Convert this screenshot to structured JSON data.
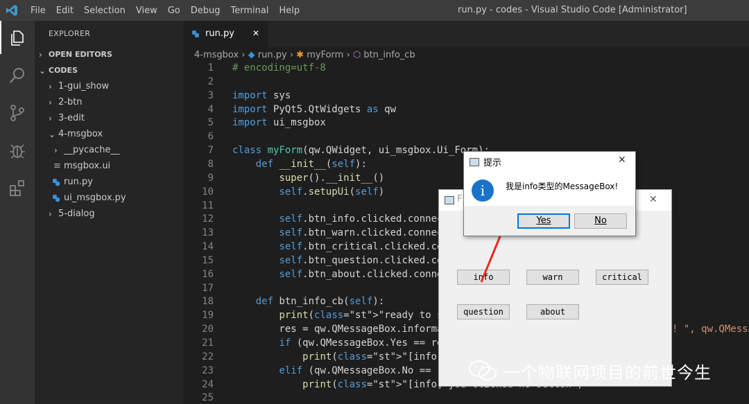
{
  "titlebar": {
    "menu": [
      "File",
      "Edit",
      "Selection",
      "View",
      "Go",
      "Debug",
      "Terminal",
      "Help"
    ],
    "window_title": "run.py - codes - Visual Studio Code [Administrator]"
  },
  "activity_bar": {
    "icons": [
      "files-icon",
      "search-icon",
      "source-control-icon",
      "debug-icon",
      "extensions-icon"
    ]
  },
  "explorer": {
    "header": "EXPLORER",
    "sections": {
      "open_editors": "OPEN EDITORS",
      "codes": "CODES"
    },
    "tree": [
      {
        "label": "1-gui_show",
        "type": "folder"
      },
      {
        "label": "2-btn",
        "type": "folder"
      },
      {
        "label": "3-edit",
        "type": "folder"
      },
      {
        "label": "4-msgbox",
        "type": "folder-open"
      },
      {
        "label": "__pycache__",
        "type": "folder"
      },
      {
        "label": "msgbox.ui",
        "type": "file"
      },
      {
        "label": "run.py",
        "type": "python"
      },
      {
        "label": "ui_msgbox.py",
        "type": "python"
      },
      {
        "label": "5-dialog",
        "type": "folder"
      }
    ]
  },
  "tab": {
    "label": "run.py",
    "close": "✕"
  },
  "breadcrumb": [
    "4-msgbox",
    "run.py",
    "myForm",
    "btn_info_cb"
  ],
  "code": {
    "line_numbers": [
      "1",
      "2",
      "3",
      "4",
      "5",
      "6",
      "7",
      "8",
      "9",
      "10",
      "11",
      "12",
      "13",
      "14",
      "15",
      "16",
      "17",
      "18",
      "19",
      "20",
      "21",
      "22",
      "23",
      "24",
      "25"
    ],
    "lines": [
      "# encoding=utf-8",
      "",
      "import sys",
      "import PyQt5.QtWidgets as qw",
      "import ui_msgbox",
      "",
      "class myForm(qw.QWidget, ui_msgbox.Ui_Form):",
      "    def __init__(self):",
      "        super().__init__()",
      "        self.setupUi(self)",
      "",
      "        self.btn_info.clicked.connect",
      "        self.btn_warn.clicked.connect",
      "        self.btn_critical.clicked.con",
      "        self.btn_question.clicked.con",
      "        self.btn_about.clicked.connec",
      "",
      "    def btn_info_cb(self):",
      "        print(\"ready to show messageb",
      "        res = qw.QMessageBox.informat",
      "        if (qw.QMessageBox.Yes == res",
      "            print(\"[info] you clicked",
      "        elif (qw.QMessageBox.No == re",
      "            print(\"[info] you clicked no button\")",
      ""
    ],
    "line20_tail": "! \", qw.QMessa"
  },
  "qt_form": {
    "title": "F",
    "close": "✕",
    "buttons": [
      "info",
      "warn",
      "critical",
      "question",
      "about"
    ]
  },
  "message_box": {
    "title": "提示",
    "close": "✕",
    "icon_text": "i",
    "message": "我是info类型的MessageBox!",
    "yes_label": "Yes",
    "no_label": "No"
  },
  "watermark": {
    "text": "一个物联网项目的前世今生"
  },
  "colors": {
    "accent_blue": "#007acc",
    "arrow_red": "#e8291c"
  }
}
